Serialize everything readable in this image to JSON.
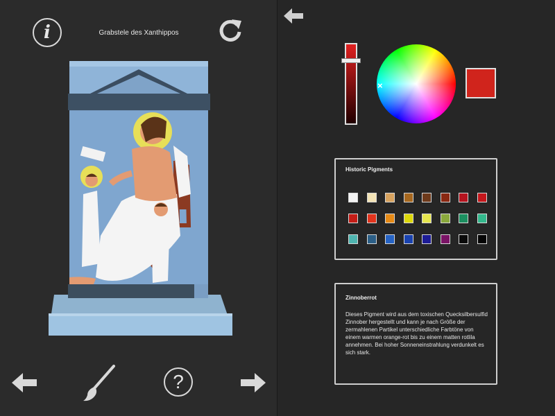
{
  "left_panel": {
    "title": "Grabstele des Xanthippos",
    "info_glyph": "i",
    "help_glyph": "?",
    "icons": [
      "info-icon",
      "reset-icon",
      "arrow-left-icon",
      "paintbrush-icon",
      "help-icon",
      "arrow-right-icon"
    ]
  },
  "color_picker": {
    "current_color": "#d0241c",
    "brightness_level": 0.82,
    "marker_glyph": "×"
  },
  "pigments": {
    "heading": "Historic Pigments",
    "colors": [
      "#f2f2f2",
      "#f3e3b5",
      "#d7a25e",
      "#a7681f",
      "#6e3a1b",
      "#8a2812",
      "#b5141f",
      "#c4171c",
      "#c41d17",
      "#e2341d",
      "#e68a16",
      "#ddd70a",
      "#e6e54e",
      "#8aa83c",
      "#1c8f60",
      "#33b88c",
      "#4fb5b0",
      "#2c5f87",
      "#2663c4",
      "#1a43b0",
      "#1d1c96",
      "#7a1365",
      "#0a0a0a",
      "#050505"
    ]
  },
  "description": {
    "title": "Zinnoberrot",
    "text": "Dieses Pigment wird aus dem toxischen Quecksilbersulfid Zinnober hergestellt und kann je nach Größe der zermahlenen Partikel unterschiedliche Farbtöne von einem warmen orange-rot bis zu einem matten rotlila annehmen. Bei hoher Sonneneinstrahlung verdunkelt es sich stark."
  }
}
